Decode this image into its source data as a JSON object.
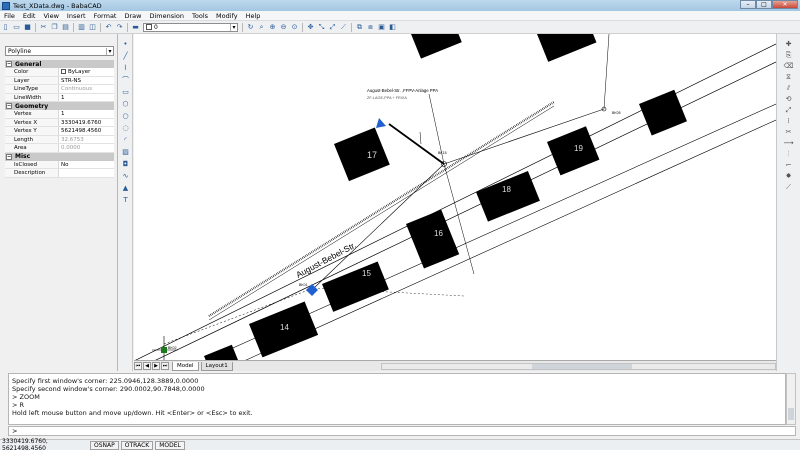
{
  "window": {
    "title": "Test_XData.dwg - BabaCAD"
  },
  "menu": [
    "File",
    "Edit",
    "View",
    "Insert",
    "Format",
    "Draw",
    "Dimension",
    "Tools",
    "Modify",
    "Help"
  ],
  "toolbar": {
    "layer_value": "0"
  },
  "properties": {
    "entity_type": "Polyline",
    "groups": [
      {
        "name": "General",
        "rows": [
          {
            "key": "Color",
            "value": "ByLayer",
            "swatch": true
          },
          {
            "key": "Layer",
            "value": "STR-NS"
          },
          {
            "key": "LineType",
            "value": "Continuous",
            "ro": true
          },
          {
            "key": "LineWidth",
            "value": "1"
          }
        ]
      },
      {
        "name": "Geometry",
        "rows": [
          {
            "key": "Vertex",
            "value": "1"
          },
          {
            "key": "Vertex X",
            "value": "3330419.6760"
          },
          {
            "key": "Vertex Y",
            "value": "5621498.4560"
          },
          {
            "key": "Length",
            "value": "32.6753",
            "ro": true
          },
          {
            "key": "Area",
            "value": "0.0000",
            "ro": true
          }
        ]
      },
      {
        "name": "Misc",
        "rows": [
          {
            "key": "IsClosed",
            "value": "No"
          },
          {
            "key": "Description",
            "value": ""
          }
        ]
      }
    ]
  },
  "drawing": {
    "street_label": "August-Bebel-Str.",
    "annotation_line1": "August-Bebel-Str. ,FFPV-Anlage PPA",
    "annotation_line2": "ZF-LAGE-PPA + FRIXA",
    "house_numbers": [
      "17",
      "18",
      "19",
      "16",
      "15",
      "14"
    ],
    "small_labels": [
      "BK15",
      "BK05",
      "BK01",
      "BK02"
    ]
  },
  "tabs": {
    "model": "Model",
    "layout": "Layout1"
  },
  "command": {
    "lines": [
      "Specify first window's corner: 225.0946,128.3889,0.0000",
      "Specify second window's corner: 290.0002,90.7848,0.0000",
      "> ZOOM",
      "> R",
      "Hold left mouse button and move up/down. Hit <Enter> or <Esc> to exit."
    ],
    "prompt": ">"
  },
  "status": {
    "coords": "3330419.6760, 5621498.4560",
    "buttons": [
      "OSNAP",
      "OTRACK",
      "MODEL"
    ]
  },
  "colors": {
    "building": "#000000",
    "accent_blue": "#2060d0",
    "marker_green": "#1c7a1c"
  }
}
